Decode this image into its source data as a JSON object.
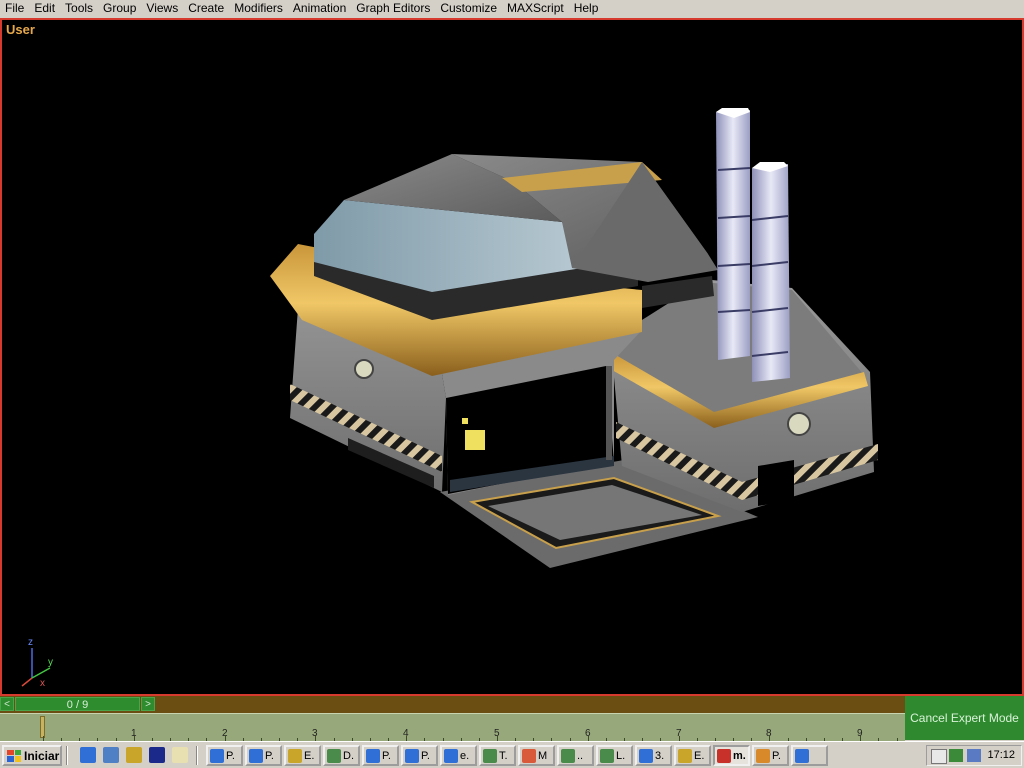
{
  "menu": [
    "File",
    "Edit",
    "Tools",
    "Group",
    "Views",
    "Create",
    "Modifiers",
    "Animation",
    "Graph Editors",
    "Customize",
    "MAXScript",
    "Help"
  ],
  "viewport": {
    "label": "User",
    "axis_labels": {
      "z": "z",
      "x": "x",
      "y": "y"
    }
  },
  "time_slider": {
    "prev_label": "<",
    "next_label": ">",
    "position_text": "0 / 9",
    "current_frame": 0,
    "total_frames": 9
  },
  "trackbar": {
    "ticks": [
      "1",
      "2",
      "3",
      "4",
      "5",
      "6",
      "7",
      "8",
      "9"
    ]
  },
  "expert_mode_label": "Cancel Expert Mode",
  "taskbar": {
    "start_label": "Iniciar",
    "quick_launch": [
      "ie-icon",
      "outlook-icon",
      "winamp-icon",
      "media-icon",
      "notes-icon"
    ],
    "tasks": [
      {
        "label": "P.",
        "icon": "ie-icon"
      },
      {
        "label": "P.",
        "icon": "ie-icon"
      },
      {
        "label": "E.",
        "icon": "search-doc-icon"
      },
      {
        "label": "D.",
        "icon": "explorer-icon"
      },
      {
        "label": "P.",
        "icon": "ie-icon"
      },
      {
        "label": "P.",
        "icon": "ie-icon"
      },
      {
        "label": "e.",
        "icon": "ie-icon"
      },
      {
        "label": "T.",
        "icon": "explorer-icon"
      },
      {
        "label": "M",
        "icon": "paint-icon"
      },
      {
        "label": "..",
        "icon": "explorer-icon"
      },
      {
        "label": "L.",
        "icon": "explorer-icon"
      },
      {
        "label": "3.",
        "icon": "ie-icon"
      },
      {
        "label": "E.",
        "icon": "search-doc-icon"
      },
      {
        "label": "m.",
        "icon": "max-icon",
        "active": true
      },
      {
        "label": "P.",
        "icon": "tool-icon"
      },
      {
        "label": "",
        "icon": "ie-icon"
      }
    ],
    "clock": "17:12"
  },
  "colors": {
    "viewport_border": "#d63a2e",
    "viewport_label": "#e6a84a",
    "slider_green": "#2e8b2e",
    "track_bg": "#97a87a",
    "expert_bg": "#2f8a2f"
  }
}
